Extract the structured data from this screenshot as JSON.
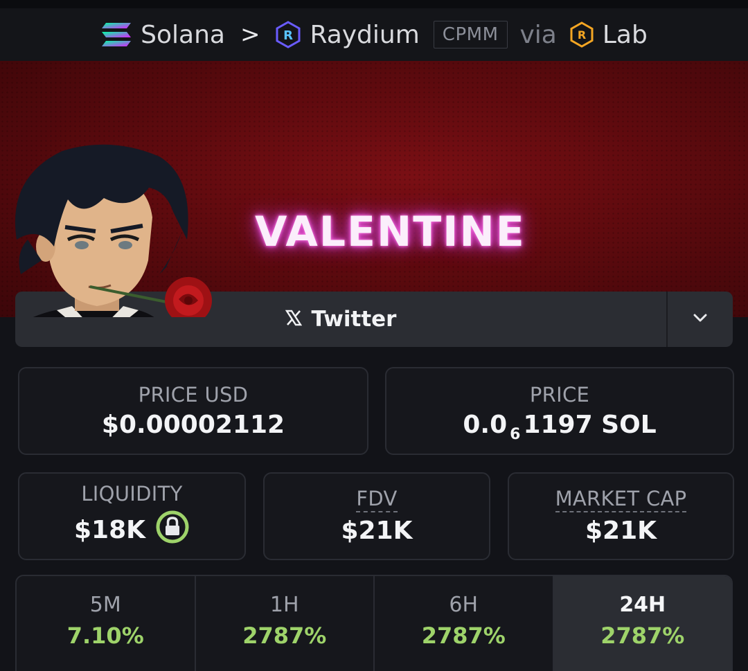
{
  "breadcrumb": {
    "chain": "Solana",
    "separator": ">",
    "dex": "Raydium",
    "pool_type": "CPMM",
    "via": "via",
    "launchpad": "Lab"
  },
  "banner": {
    "title": "VALENTINE"
  },
  "socials": {
    "twitter_label": "Twitter"
  },
  "stats": {
    "price_usd_label": "PRICE USD",
    "price_usd_value": "$0.00002112",
    "price_label": "PRICE",
    "price_prefix": "0.0",
    "price_subscript": "6",
    "price_suffix": "1197 SOL",
    "liquidity_label": "LIQUIDITY",
    "liquidity_value": "$18K",
    "fdv_label": "FDV",
    "fdv_value": "$21K",
    "mcap_label": "MARKET CAP",
    "mcap_value": "$21K"
  },
  "changes": [
    {
      "label": "5M",
      "value": "7.10%"
    },
    {
      "label": "1H",
      "value": "2787%"
    },
    {
      "label": "6H",
      "value": "2787%"
    },
    {
      "label": "24H",
      "value": "2787%"
    }
  ],
  "colors": {
    "positive": "#9ed36a",
    "lock_green": "#9ed36a",
    "banner_red": "#6b0c11",
    "neon_pink": "#e64dd6"
  }
}
